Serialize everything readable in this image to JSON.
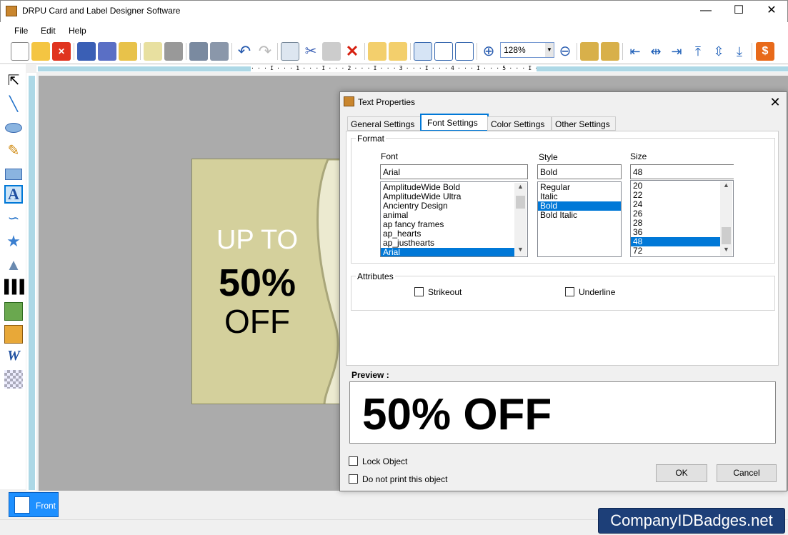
{
  "window": {
    "title": "DRPU Card and Label Designer Software",
    "minimize": "—",
    "maximize": "☐",
    "close": "✕"
  },
  "menu": {
    "file": "File",
    "edit": "Edit",
    "help": "Help"
  },
  "toolbar": {
    "zoom": "128%"
  },
  "ruler": {
    "marks": "· · · I · · · 1 · · · I · · · 2 · · · I · · · 3 · · · I · · · 4 · · · I · · · 5 · · · I · · · 6 · · · I · · · 7 · · · I · · · 8 · · · I · · · 9 · · · I · · · 10 · · ·"
  },
  "card": {
    "line1": "UP TO",
    "line2": "50%",
    "line3": "OFF"
  },
  "pages": {
    "front": "Front"
  },
  "watermark": "CompanyIDBadges.net",
  "dialog": {
    "title": "Text Properties",
    "close": "✕",
    "tabs": [
      "General Settings",
      "Font Settings",
      "Color Settings",
      "Other Settings"
    ],
    "format_label": "Format",
    "font_label": "Font",
    "font_value": "Arial",
    "font_list": [
      "AmplitudeWide Bold",
      "AmplitudeWide Ultra",
      "Ancientry  Design",
      "animal",
      "ap fancy frames",
      "ap_hearts",
      "ap_justhearts",
      "Arial"
    ],
    "style_label": "Style",
    "style_value": "Bold",
    "style_list": [
      "Regular",
      "Italic",
      "Bold",
      "Bold Italic"
    ],
    "size_label": "Size",
    "size_value": "48",
    "size_list": [
      "20",
      "22",
      "24",
      "26",
      "28",
      "36",
      "48",
      "72"
    ],
    "attributes_label": "Attributes",
    "strikeout": "Strikeout",
    "underline": "Underline",
    "preview_label": "Preview :",
    "preview_text": "50% OFF",
    "lock_object": "Lock Object",
    "do_not_print": "Do not print this object",
    "ok": "OK",
    "cancel": "Cancel"
  },
  "colors": {
    "accent": "#0078d7",
    "card": "#d4d09c",
    "watermark": "#1d3f78"
  }
}
